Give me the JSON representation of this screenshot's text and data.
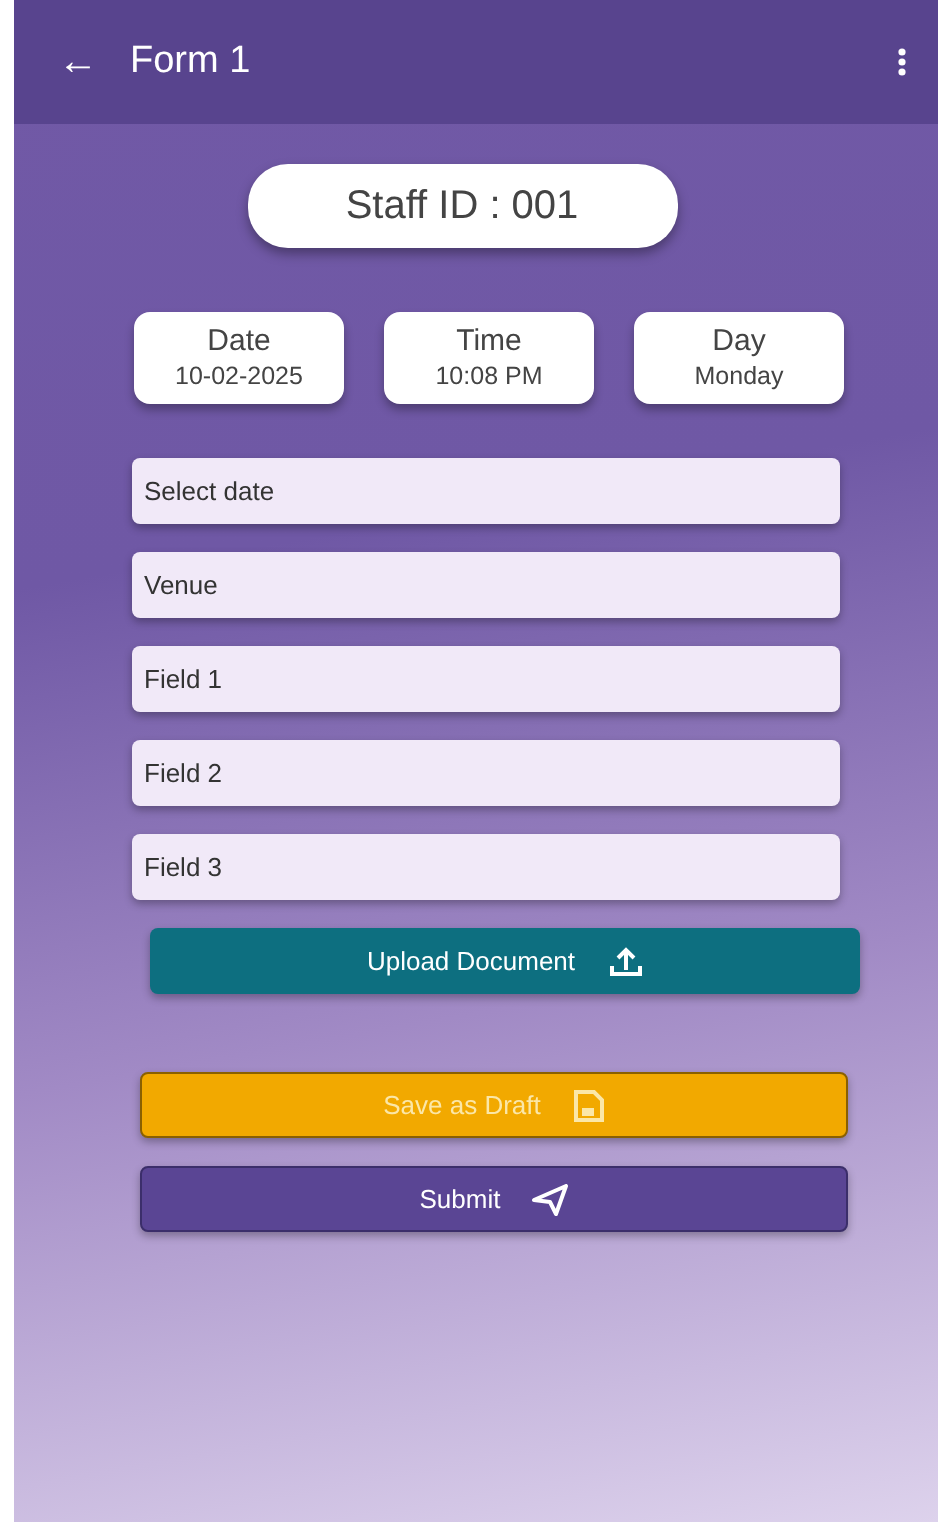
{
  "app_bar": {
    "back_icon": "←",
    "title": "Form 1"
  },
  "staff_id": "Staff ID : 001",
  "info_cards": [
    {
      "label": "Date",
      "value": "10-02-2025"
    },
    {
      "label": "Time",
      "value": "10:08 PM"
    },
    {
      "label": "Day",
      "value": "Monday"
    }
  ],
  "fields": [
    {
      "placeholder": "Select date"
    },
    {
      "placeholder": "Venue"
    },
    {
      "placeholder": "Field 1"
    },
    {
      "placeholder": "Field 2"
    },
    {
      "placeholder": "Field 3"
    }
  ],
  "buttons": [
    {
      "kind": "upload",
      "label": "Upload Document"
    },
    {
      "kind": "draft",
      "label": "Save as Draft"
    },
    {
      "kind": "submit",
      "label": "Submit"
    }
  ]
}
